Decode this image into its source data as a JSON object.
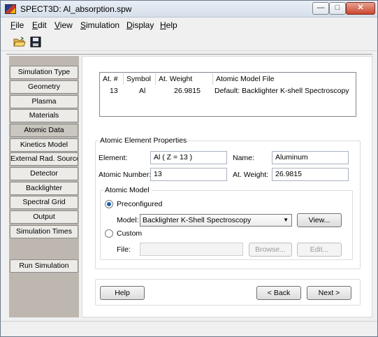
{
  "window": {
    "title": "SPECT3D:  Al_absorption.spw"
  },
  "menubar": {
    "items": [
      {
        "label": "File",
        "mnemonic": "F"
      },
      {
        "label": "Edit",
        "mnemonic": "E"
      },
      {
        "label": "View",
        "mnemonic": "V"
      },
      {
        "label": "Simulation",
        "mnemonic": "S"
      },
      {
        "label": "Display",
        "mnemonic": "D"
      },
      {
        "label": "Help",
        "mnemonic": "H"
      }
    ]
  },
  "toolbar": {
    "open_icon": "open-folder-icon",
    "save_icon": "save-disk-icon"
  },
  "sidebar": {
    "items": [
      {
        "label": "Simulation Type"
      },
      {
        "label": "Geometry"
      },
      {
        "label": "Plasma"
      },
      {
        "label": "Materials"
      },
      {
        "label": "Atomic Data",
        "active": true
      },
      {
        "label": "Kinetics Model"
      },
      {
        "label": "External Rad. Source"
      },
      {
        "label": "Detector"
      },
      {
        "label": "Backlighter"
      },
      {
        "label": "Spectral Grid"
      },
      {
        "label": "Output"
      },
      {
        "label": "Simulation Times"
      }
    ],
    "run_label": "Run Simulation"
  },
  "table": {
    "headers": [
      "At. #",
      "Symbol",
      "At. Weight",
      "Atomic Model File"
    ],
    "rows": [
      [
        "13",
        "Al",
        "26.9815",
        "Default:  Backlighter K-shell Spectroscopy"
      ]
    ]
  },
  "properties": {
    "title": "Atomic Element Properties",
    "element_label": "Element:",
    "element_value": "Al  ( Z = 13 )",
    "name_label": "Name:",
    "name_value": "Aluminum",
    "atomic_number_label": "Atomic Number:",
    "atomic_number_value": "13",
    "atomic_weight_label": "At. Weight:",
    "atomic_weight_value": "26.9815"
  },
  "atomic_model": {
    "title": "Atomic Model",
    "preconfigured_label": "Preconfigured",
    "model_label": "Model:",
    "model_value": "Backlighter K-Shell Spectroscopy",
    "view_button": "View...",
    "custom_label": "Custom",
    "file_label": "File:",
    "file_value": "",
    "browse_button": "Browse...",
    "edit_button": "Edit...",
    "selected": "preconfigured"
  },
  "nav": {
    "help": "Help",
    "back": "< Back",
    "next": "Next >"
  },
  "colors": {
    "sidebar_bg": "#bdb7b0",
    "accent": "#1d5cb3"
  }
}
